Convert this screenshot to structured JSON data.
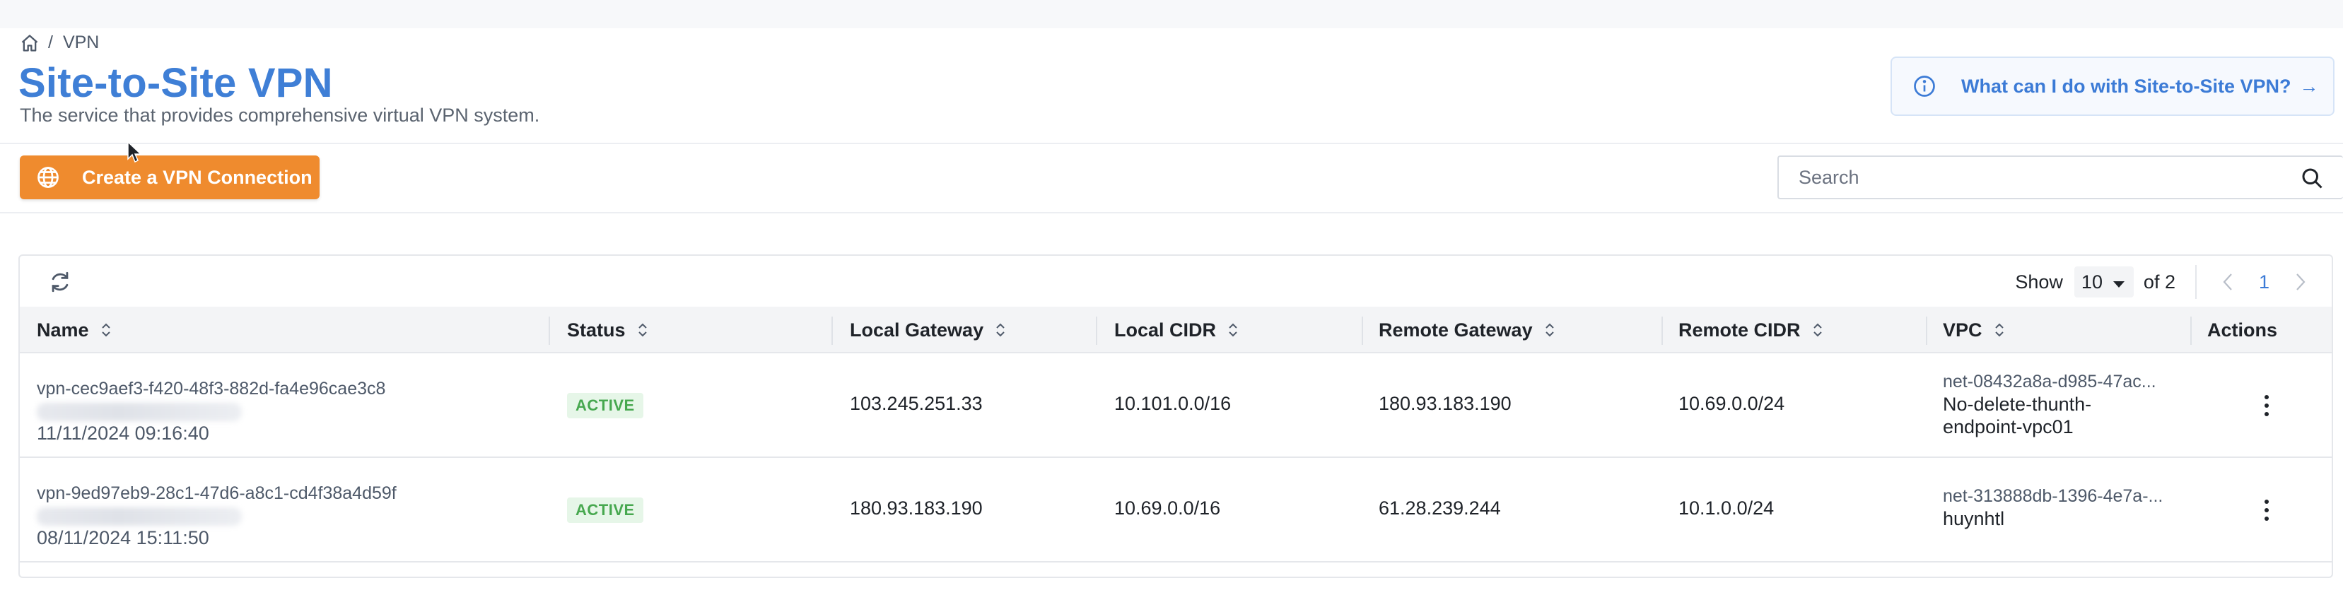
{
  "breadcrumb": {
    "home_icon": "home-icon",
    "separator": "/",
    "current": "VPN"
  },
  "header": {
    "title": "Site-to-Site VPN",
    "subtitle": "The service that provides comprehensive virtual VPN system."
  },
  "help": {
    "icon": "info-icon",
    "text": "What can I do with Site-to-Site VPN?",
    "arrow": "→"
  },
  "toolbar": {
    "create_label": "Create a VPN Connection",
    "create_icon": "globe-icon",
    "create_color": "#ef8b2e"
  },
  "search": {
    "placeholder": "Search",
    "value": "",
    "icon": "search-icon"
  },
  "pagination": {
    "show_label": "Show",
    "page_size": "10",
    "of_label": "of 2",
    "current_page": "1"
  },
  "table": {
    "columns": [
      {
        "key": "name",
        "label": "Name"
      },
      {
        "key": "status",
        "label": "Status"
      },
      {
        "key": "local_gateway",
        "label": "Local Gateway"
      },
      {
        "key": "local_cidr",
        "label": "Local CIDR"
      },
      {
        "key": "remote_gateway",
        "label": "Remote Gateway"
      },
      {
        "key": "remote_cidr",
        "label": "Remote CIDR"
      },
      {
        "key": "vpc",
        "label": "VPC"
      },
      {
        "key": "actions",
        "label": "Actions"
      }
    ],
    "rows": [
      {
        "id": "vpn-cec9aef3-f420-48f3-882d-fa4e96cae3c8",
        "date": "11/11/2024 09:16:40",
        "status": "ACTIVE",
        "local_gateway": "103.245.251.33",
        "local_cidr": "10.101.0.0/16",
        "remote_gateway": "180.93.183.190",
        "remote_cidr": "10.69.0.0/24",
        "vpc_id": "net-08432a8a-d985-47ac...",
        "vpc_name": "No-delete-thunth-endpoint-vpc01"
      },
      {
        "id": "vpn-9ed97eb9-28c1-47d6-a8c1-cd4f38a4d59f",
        "date": "08/11/2024 15:11:50",
        "status": "ACTIVE",
        "local_gateway": "180.93.183.190",
        "local_cidr": "10.69.0.0/16",
        "remote_gateway": "61.28.239.244",
        "remote_cidr": "10.1.0.0/24",
        "vpc_id": "net-313888db-1396-4e7a-...",
        "vpc_name": "huynhtl"
      }
    ]
  },
  "colors": {
    "accent_blue": "#3f7fd6",
    "status_active_bg": "#e6f6e8",
    "status_active_text": "#47a84f"
  }
}
